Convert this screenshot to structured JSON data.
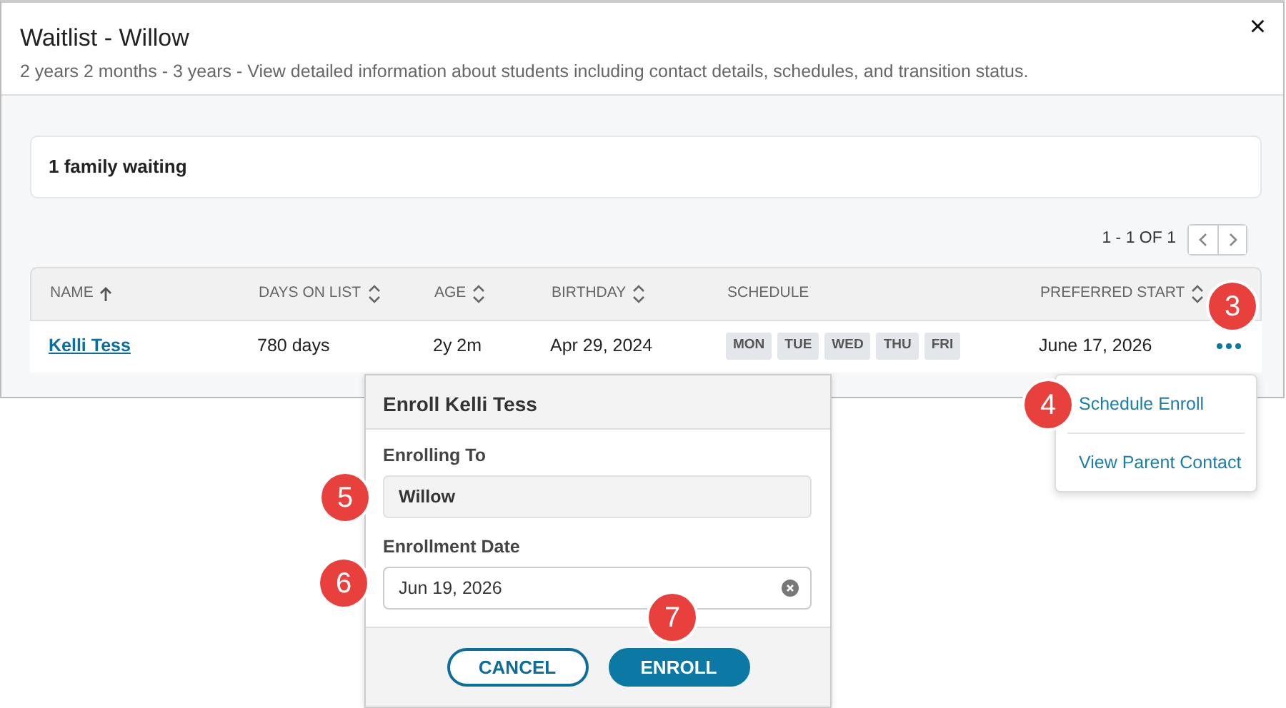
{
  "modal": {
    "title": "Waitlist - Willow",
    "subtitle": "2 years 2 months - 3 years - View detailed information about students including contact details, schedules, and transition status.",
    "close": "×"
  },
  "summary": "1 family waiting",
  "pagination": {
    "range": "1 - 1 OF 1"
  },
  "table": {
    "columns": [
      {
        "label": "NAME",
        "kind": "sorted"
      },
      {
        "label": "DAYS ON LIST",
        "kind": "sortable"
      },
      {
        "label": "AGE",
        "kind": "sortable"
      },
      {
        "label": "BIRTHDAY",
        "kind": "sortable"
      },
      {
        "label": "SCHEDULE",
        "kind": "plain"
      },
      {
        "label": "PREFERRED START",
        "kind": "sortable"
      }
    ],
    "rows": [
      {
        "name": "Kelli Tess",
        "days": "780 days",
        "age": "2y 2m",
        "birthday": "Apr 29, 2024",
        "schedule": [
          "MON",
          "TUE",
          "WED",
          "THU",
          "FRI"
        ],
        "preferred_start": "June 17, 2026"
      }
    ]
  },
  "row_menu": {
    "items": [
      "Schedule Enroll",
      "View Parent Contact"
    ]
  },
  "enroll_popover": {
    "title": "Enroll Kelli Tess",
    "fields": [
      {
        "label": "Enrolling To",
        "value": "Willow",
        "disabled": true
      },
      {
        "label": "Enrollment Date",
        "value": "Jun 19, 2026",
        "disabled": false
      }
    ],
    "buttons": [
      {
        "label": "CANCEL",
        "kind": "outline"
      },
      {
        "label": "ENROLL",
        "kind": "primary"
      }
    ]
  },
  "callouts": [
    "3",
    "4",
    "5",
    "6",
    "7"
  ]
}
